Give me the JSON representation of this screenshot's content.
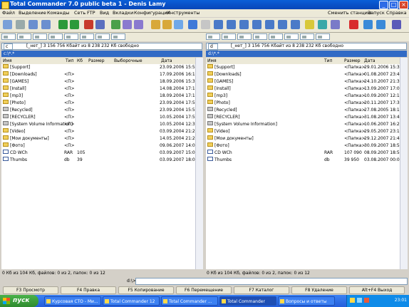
{
  "window": {
    "title": "Total Commander 7.0 public beta 1 - Denis Lamy"
  },
  "menu": {
    "left": [
      "Файл",
      "Выделение",
      "Команды",
      "Сеть",
      "FTP",
      "Вид",
      "Вкладки",
      "Конфигурация",
      "Инструменты"
    ],
    "right": [
      "Сменить станцию",
      "Запуск",
      "Справка"
    ]
  },
  "left": {
    "drive": "c",
    "info": "[_нет_]  3 156 756 Кбайт из 8 238 232 Кб свободно",
    "path": "c:\\*.*",
    "headers": {
      "name": "Имя",
      "ext": "Тип",
      "size": "Кб",
      "size2": "Размер",
      "desc": "Выборочные",
      "date": "Дата"
    },
    "rows": [
      {
        "name": "[Support]",
        "ext": "",
        "date": "23.09.2006 15:57",
        "icon": "folder"
      },
      {
        "name": "[Downloads]",
        "ext": "<П>",
        "date": "17.09.2006 16:13",
        "icon": "folder"
      },
      {
        "name": "[GAMES]",
        "ext": "<П>",
        "date": "18.09.2006 15:30",
        "icon": "folder"
      },
      {
        "name": "[Install]",
        "ext": "<П>",
        "date": "14.08.2004 17:17",
        "icon": "folder"
      },
      {
        "name": "[mp3]",
        "ext": "<П>",
        "date": "18.09.2004 17:17",
        "icon": "folder"
      },
      {
        "name": "[Photo]",
        "ext": "<П>",
        "date": "23.09.2004 17:51",
        "icon": "folder"
      },
      {
        "name": "[Recycled]",
        "ext": "<П>",
        "date": "23.09.2004 15:53",
        "icon": "sys"
      },
      {
        "name": "[RECYCLER]",
        "ext": "<П>",
        "date": "10.05.2004 17:59",
        "icon": "sys"
      },
      {
        "name": "[System Volume Information]",
        "ext": "<П>",
        "date": "10.05.2004 12:33",
        "icon": "sys"
      },
      {
        "name": "[Video]",
        "ext": "<П>",
        "date": "03.09.2004 21:25",
        "icon": "folder"
      },
      {
        "name": "[Мои документы]",
        "ext": "<П>",
        "date": "14.05.2004 21:28",
        "icon": "folder"
      },
      {
        "name": "[Фото]",
        "ext": "<П>",
        "date": "09.06.2007 14:00",
        "icon": "folder"
      },
      {
        "name": "CD WCh",
        "ext": "RAR",
        "size": "105",
        "date": "03.09.2007 15:09",
        "icon": "file"
      },
      {
        "name": "Thumbs",
        "ext": "db",
        "size": "39",
        "date": "03.09.2007 18:03",
        "icon": "file"
      }
    ],
    "status": "0 Кб из 104 Кб, файлов: 0 из 2, папок: 0 из 12"
  },
  "right": {
    "drive": "d",
    "info": "[_нет_]  3 156 756 Кбайт из 8 238 232 Кб свободно",
    "path": "d:\\*.*",
    "headers": {
      "name": "Имя",
      "ext": "Тип",
      "size": "Размер",
      "date": "Дата"
    },
    "rows": [
      {
        "name": "[Support]",
        "size": "<Папка>",
        "date": "29.01.2006 15:30",
        "icon": "folder"
      },
      {
        "name": "[Downloads]",
        "size": "<Папка>",
        "date": "01.08.2007 23:41",
        "icon": "folder"
      },
      {
        "name": "[GAMES]",
        "size": "<Папка>",
        "date": "24.10.2007 21:37",
        "icon": "folder"
      },
      {
        "name": "[Install]",
        "size": "<Папка>",
        "date": "13.09.2007 17:07",
        "icon": "folder"
      },
      {
        "name": "[mp3]",
        "size": "<Папка>",
        "date": "10.09.2007 12:11",
        "icon": "folder"
      },
      {
        "name": "[Photo]",
        "size": "<Папка>",
        "date": "20.11.2007 17:30",
        "icon": "folder"
      },
      {
        "name": "[Recycled]",
        "size": "<Папка>",
        "date": "27.08.2005 18:19",
        "icon": "sys"
      },
      {
        "name": "[RECYCLER]",
        "size": "<Папка>",
        "date": "31.08.2007 13:49",
        "icon": "sys"
      },
      {
        "name": "[System Volume Information]",
        "size": "<Папка>",
        "date": "10.06.2007 16:28",
        "icon": "sys"
      },
      {
        "name": "[Video]",
        "size": "<Папка>",
        "date": "29.05.2007 23:12",
        "icon": "folder"
      },
      {
        "name": "[Мои документы]",
        "size": "<Папка>",
        "date": "29.12.2007 21:49",
        "icon": "folder"
      },
      {
        "name": "[Фото]",
        "size": "<Папка>",
        "date": "30.09.2007 18:53",
        "icon": "folder"
      },
      {
        "name": "CD WCh",
        "ext": "RAR",
        "size": "107 090",
        "date": "08.09.2007 18:53",
        "icon": "file"
      },
      {
        "name": "Thumbs",
        "ext": "db",
        "size": "39 950",
        "date": "03.08.2007 00:03",
        "icon": "file"
      }
    ],
    "status": "0 Кб из 104 Кб, файлов: 0 из 2, папок: 0 из 12"
  },
  "cmdline": {
    "label": "d:\\>"
  },
  "fkeys": [
    "F3 Просмотр",
    "F4 Правка",
    "F5 Копирование",
    "F6 Перемещение",
    "F7 Каталог",
    "F8 Удаление",
    "Alt+F4 Выход"
  ],
  "taskbar": {
    "start": "пуск",
    "tasks": [
      "Курсовая СТО - Ми...",
      "Total Commander 12",
      "Total Commander ...",
      "Total Commander",
      "Вопросы и ответы"
    ],
    "clock": "23:01"
  }
}
